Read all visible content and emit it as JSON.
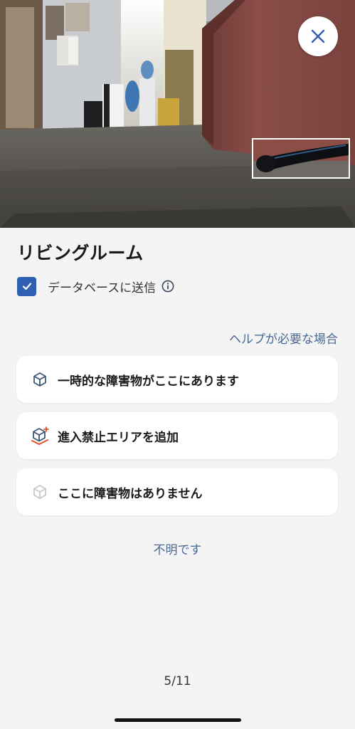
{
  "room": {
    "title": "リビングルーム"
  },
  "database": {
    "checked": true,
    "label": "データベースに送信"
  },
  "help_link": "ヘルプが必要な場合",
  "options": [
    {
      "icon": "cube-outline-icon",
      "label": "一時的な障害物がここにあります"
    },
    {
      "icon": "cube-no-go-zone-icon",
      "label": "進入禁止エリアを追加"
    },
    {
      "icon": "cube-light-icon",
      "label": "ここに障害物はありません"
    }
  ],
  "unknown_link": "不明です",
  "pager": "5/11",
  "colors": {
    "accent": "#2f5fb0",
    "link": "#4a6a92",
    "background": "#f4f4f4",
    "card": "#ffffff",
    "no_go_zone": "#e0502a"
  }
}
